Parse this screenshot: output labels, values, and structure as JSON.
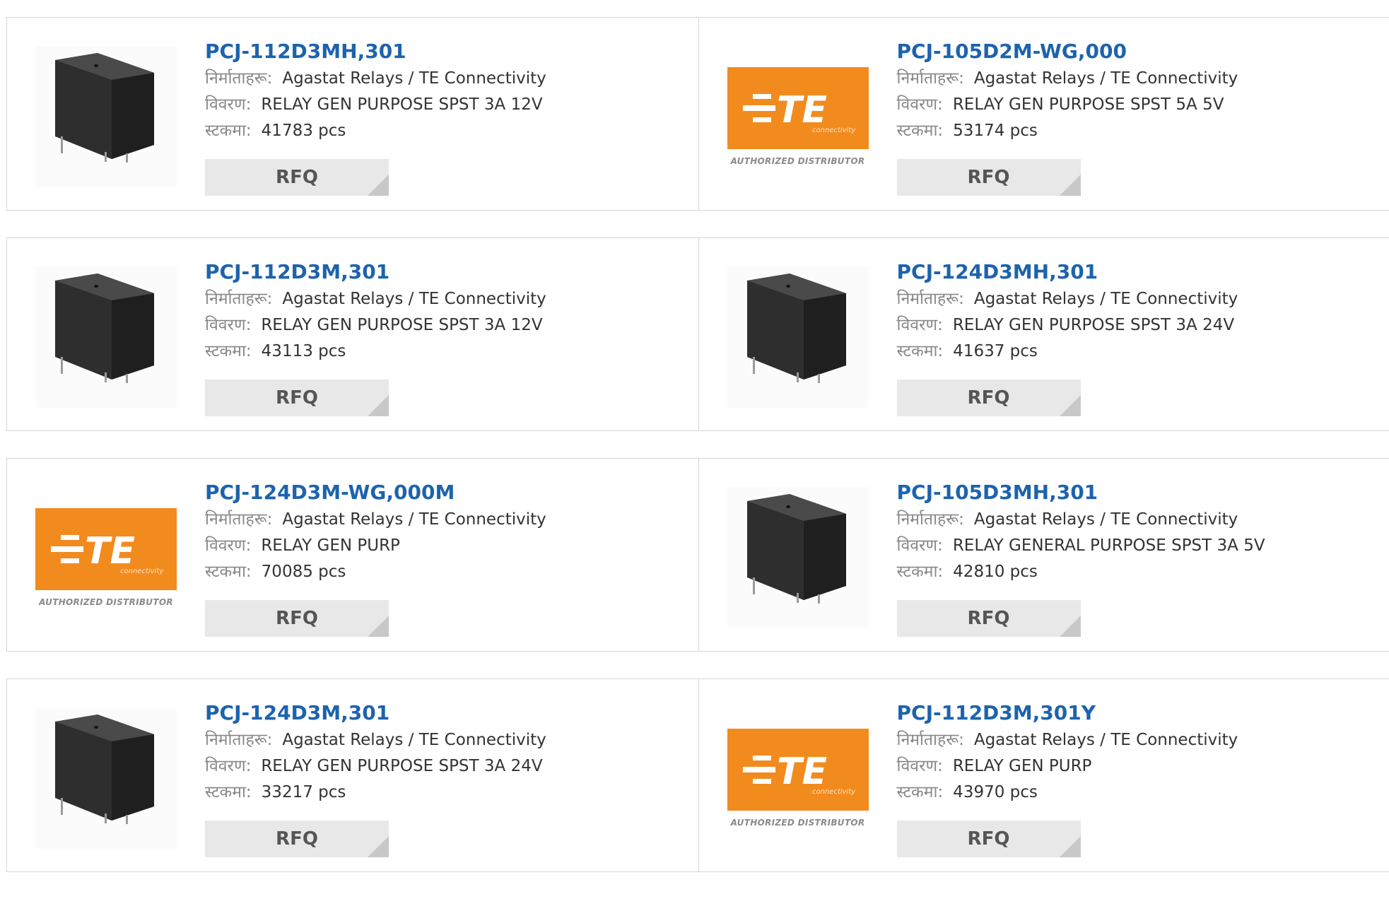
{
  "labels": {
    "manufacturer": "निर्माताहरू:",
    "description": "विवरण:",
    "stock": "स्टकमा:",
    "rfq": "RFQ",
    "te_authorized": "AUTHORIZED DISTRIBUTOR",
    "te_brand": "TE",
    "te_tagline": "connectivity"
  },
  "colors": {
    "part_link": "#1d63ad",
    "te_orange": "#f28b1e",
    "rfq_bg": "#e8e8e8"
  },
  "products": [
    {
      "part": "PCJ-112D3MH,301",
      "manufacturer": "Agastat Relays / TE Connectivity",
      "description": "RELAY GEN PURPOSE SPST 3A 12V",
      "stock": "41783 pcs",
      "image": "relay-icon"
    },
    {
      "part": "PCJ-105D2M-WG,000",
      "manufacturer": "Agastat Relays / TE Connectivity",
      "description": "RELAY GEN PURPOSE SPST 5A 5V",
      "stock": "53174 pcs",
      "image": "te-logo"
    },
    {
      "part": "PCJ-112D3M,301",
      "manufacturer": "Agastat Relays / TE Connectivity",
      "description": "RELAY GEN PURPOSE SPST 3A 12V",
      "stock": "43113 pcs",
      "image": "relay-icon"
    },
    {
      "part": "PCJ-124D3MH,301",
      "manufacturer": "Agastat Relays / TE Connectivity",
      "description": "RELAY GEN PURPOSE SPST 3A 24V",
      "stock": "41637 pcs",
      "image": "relay-icon"
    },
    {
      "part": "PCJ-124D3M-WG,000M",
      "manufacturer": "Agastat Relays / TE Connectivity",
      "description": "RELAY GEN PURP",
      "stock": "70085 pcs",
      "image": "te-logo"
    },
    {
      "part": "PCJ-105D3MH,301",
      "manufacturer": "Agastat Relays / TE Connectivity",
      "description": "RELAY GENERAL PURPOSE SPST 3A 5V",
      "stock": "42810 pcs",
      "image": "relay-icon"
    },
    {
      "part": "PCJ-124D3M,301",
      "manufacturer": "Agastat Relays / TE Connectivity",
      "description": "RELAY GEN PURPOSE SPST 3A 24V",
      "stock": "33217 pcs",
      "image": "relay-icon"
    },
    {
      "part": "PCJ-112D3M,301Y",
      "manufacturer": "Agastat Relays / TE Connectivity",
      "description": "RELAY GEN PURP",
      "stock": "43970 pcs",
      "image": "te-logo"
    }
  ]
}
